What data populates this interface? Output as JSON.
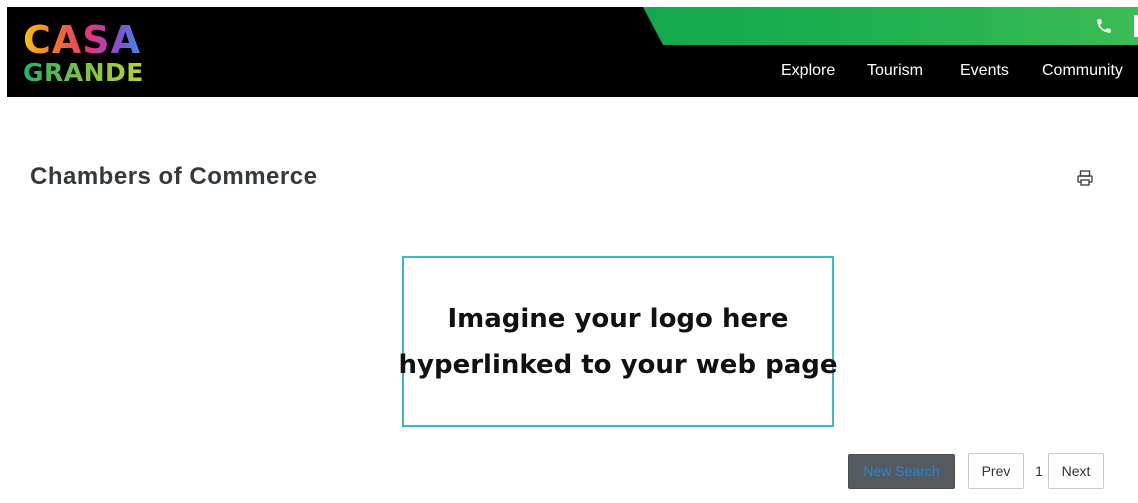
{
  "header": {
    "logo": {
      "line1": "CASA",
      "line2": "GRANDE"
    },
    "nav": [
      {
        "label": "Explore"
      },
      {
        "label": "Tourism"
      },
      {
        "label": "Events"
      },
      {
        "label": "Community"
      }
    ],
    "phone_icon": "phone-icon",
    "colors": {
      "bar": "#000000",
      "green": "#23b14f"
    }
  },
  "main": {
    "title": "Chambers of Commerce",
    "print_icon": "printer-icon",
    "ad": {
      "line1": "Imagine your logo here",
      "line2": "hyperlinked to your web page",
      "border_color": "#3fb3d0"
    }
  },
  "pagination": {
    "new_search_label": "New Search",
    "prev_label": "Prev",
    "current_page": "1",
    "next_label": "Next"
  }
}
